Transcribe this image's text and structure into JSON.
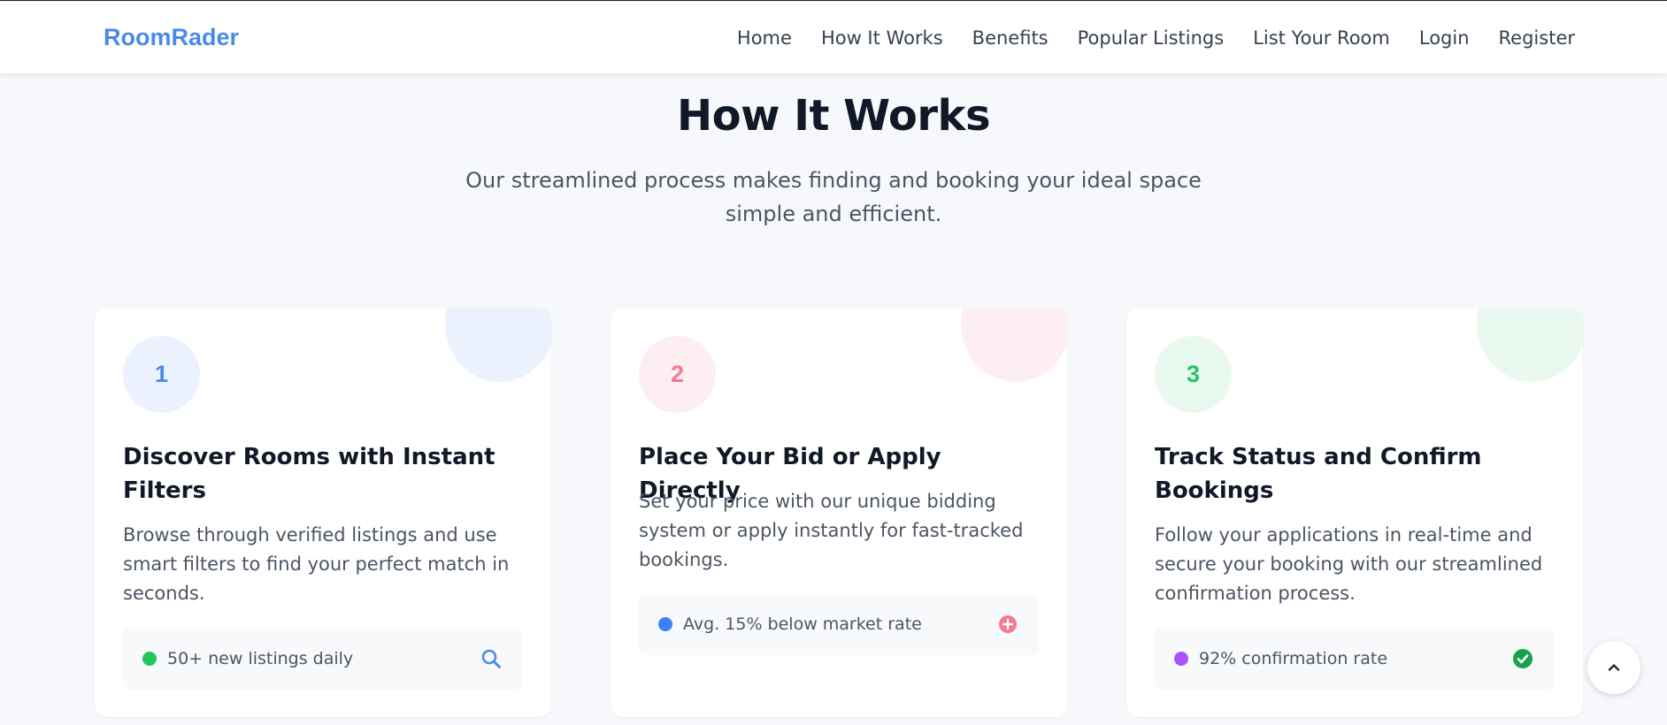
{
  "nav": {
    "brand": "RoomRader",
    "links": [
      "Home",
      "How It Works",
      "Benefits",
      "Popular Listings",
      "List Your Room",
      "Login",
      "Register"
    ]
  },
  "hero": {
    "title": "How It Works",
    "subtitle": "Our streamlined process makes finding and booking your ideal space simple and efficient."
  },
  "cards": [
    {
      "number": "1",
      "title": "Discover Rooms with Instant Filters",
      "description": "Browse through verified listings and use smart filters to find your perfect match in seconds.",
      "stat": "50+ new listings daily",
      "icon": "search-icon",
      "accent": "#4a8be6",
      "tint": "#ebf1fd"
    },
    {
      "number": "2",
      "title": "Place Your Bid or Apply Directly",
      "description": "Set your price with our unique bidding system or apply instantly for fast-tracked bookings.",
      "stat": "Avg. 15% below market rate",
      "icon": "plus-circle-icon",
      "accent": "#f47a92",
      "tint": "#fdeef1"
    },
    {
      "number": "3",
      "title": "Track Status and Confirm Bookings",
      "description": "Follow your applications in real-time and secure your booking with our streamlined confirmation process.",
      "stat": "92% confirmation rate",
      "icon": "check-circle-icon",
      "accent": "#22c55e",
      "tint": "#e9f9ef"
    }
  ],
  "stat_dot_colors": [
    "#22c55e",
    "#3b82f6",
    "#a855f7"
  ],
  "scroll_top_icon": "chevron-up-icon"
}
